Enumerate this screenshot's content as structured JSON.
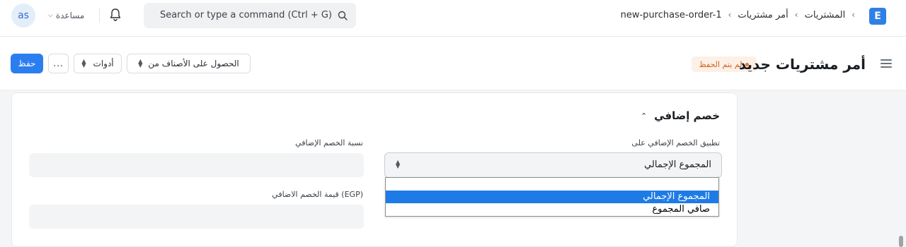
{
  "navbar": {
    "avatar_initials": "as",
    "help_label": "مساعدة",
    "search_placeholder": "Search or type a command (Ctrl + G)",
    "breadcrumbs": [
      "المشتريات",
      "أمر مشتريات",
      "new-purchase-order-1"
    ],
    "logo_letter": "E"
  },
  "header": {
    "title": "أمر مشتريات جديد",
    "status_badge": "لم يتم الحفظ",
    "save_label": "حفظ",
    "more_label": "...",
    "tools_label": "أدوات",
    "get_items_label": "الحصول على الأصناف من"
  },
  "section": {
    "title": "خصم إضافي",
    "apply_discount_on_label": "تطبيق الخصم الإضافي على",
    "apply_discount_on_value": "المجموع الإجمالي",
    "discount_percentage_label": "نسبة الخصم الإضافي",
    "discount_amount_label": "قيمة الخصم الاضافي (EGP)",
    "discount_percentage_value": "",
    "discount_amount_value": ""
  },
  "dropdown": {
    "options": [
      "",
      "المجموع الإجمالي",
      "صافي المجموع"
    ],
    "selected_index": 1
  },
  "colors": {
    "primary": "#2b7ef0",
    "badge_text": "#d06524",
    "badge_bg": "#fdf0e7",
    "option_highlight": "#1e7be6"
  }
}
